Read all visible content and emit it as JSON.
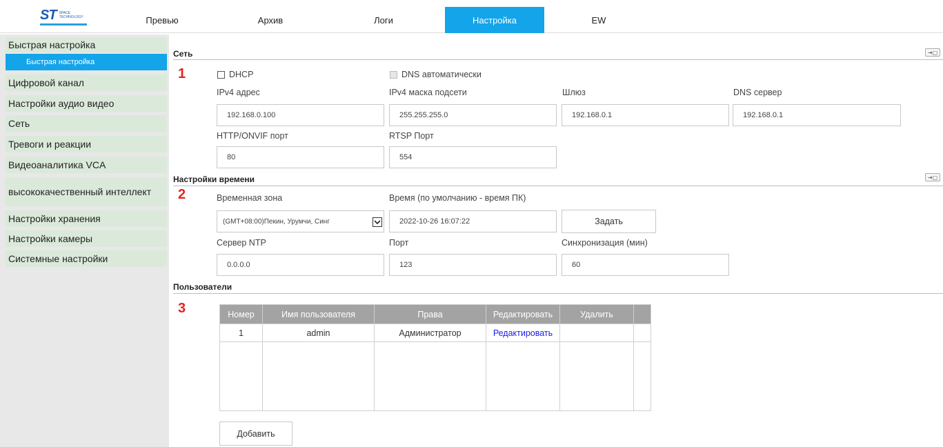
{
  "logo": {
    "text": "ST",
    "sub1": "SPACE",
    "sub2": "TECHNOLOGY"
  },
  "nav": {
    "tabs": [
      {
        "label": "Превью"
      },
      {
        "label": "Архив"
      },
      {
        "label": "Логи"
      },
      {
        "label": "Настройка",
        "active": true
      },
      {
        "label": "EW"
      }
    ]
  },
  "sidebar": {
    "items": [
      {
        "label": "Быстрая настройка"
      },
      {
        "label": "Быстрая настройка",
        "sub": true,
        "active": true
      },
      {
        "label": "Цифровой канал"
      },
      {
        "label": "Настройки аудио видео"
      },
      {
        "label": "Сеть"
      },
      {
        "label": "Тревоги и реакции"
      },
      {
        "label": "Видеоаналитика VCA"
      },
      {
        "label": "высококачественный интеллект"
      },
      {
        "label": "Настройки хранения"
      },
      {
        "label": "Настройки камеры"
      },
      {
        "label": "Системные настройки"
      }
    ]
  },
  "network": {
    "title": "Сеть",
    "marker": "1",
    "dhcp_label": "DHCP",
    "dns_auto_label": "DNS автоматически",
    "ipv4_label": "IPv4 адрес",
    "ipv4_value": "192.168.0.100",
    "mask_label": "IPv4 маска подсети",
    "mask_value": "255.255.255.0",
    "gateway_label": "Шлюз",
    "gateway_value": "192.168.0.1",
    "dns_label": "DNS сервер",
    "dns_value": "192.168.0.1",
    "http_label": "HTTP/ONVIF порт",
    "http_value": "80",
    "rtsp_label": "RTSP Порт",
    "rtsp_value": "554"
  },
  "time": {
    "title": "Настройки времени",
    "marker": "2",
    "tz_label": "Временная зона",
    "tz_value": "(GMT+08:00)Пекин, Урумчи, Синг",
    "time_label": "Время (по умолчанию - время ПК)",
    "time_value": "2022-10-26 16:07:22",
    "set_button": "Задать",
    "ntp_label": "Сервер NTP",
    "ntp_value": "0.0.0.0",
    "port_label": "Порт",
    "port_value": "123",
    "sync_label": "Синхронизация (мин)",
    "sync_value": "60"
  },
  "users": {
    "title": "Пользователи",
    "marker": "3",
    "columns": [
      "Номер",
      "Имя пользователя",
      "Права",
      "Редактировать",
      "Удалить"
    ],
    "rows": [
      {
        "num": "1",
        "name": "admin",
        "rights": "Администратор",
        "edit": "Редактировать",
        "delete": ""
      }
    ],
    "add_button": "Добавить"
  },
  "colors": {
    "accent": "#13a4ea",
    "marker": "#e0261e",
    "sidebar_item": "#dbe9da",
    "table_header": "#a3a3a3",
    "link": "#1a1aee"
  }
}
